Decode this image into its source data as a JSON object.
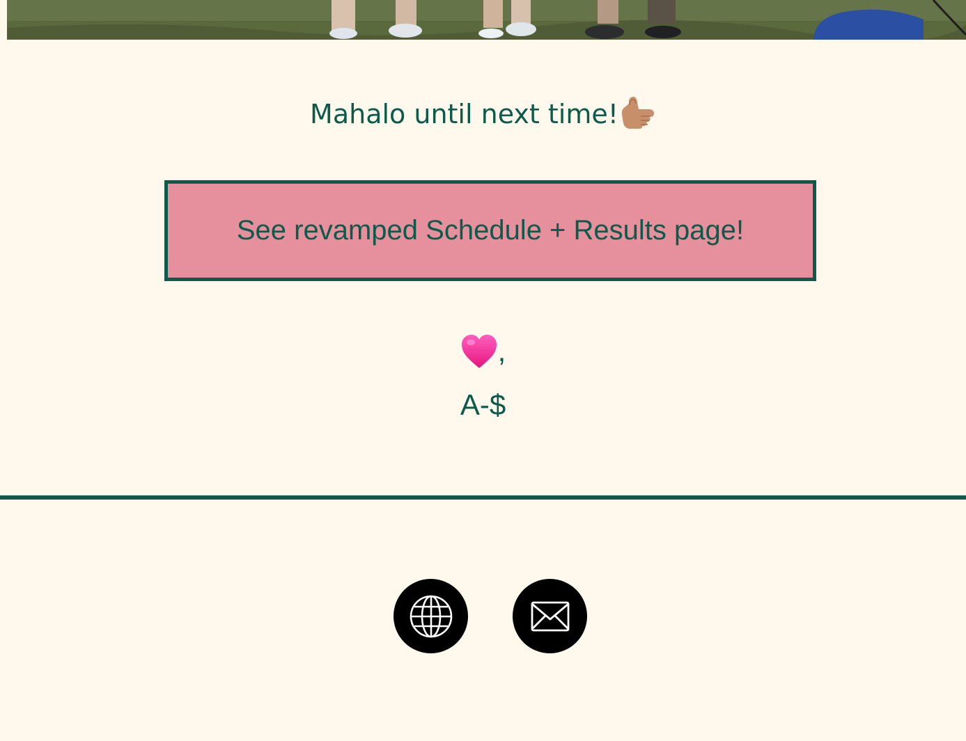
{
  "footer_message": {
    "text": "Mahalo until next time!",
    "emoji_icon": "call-me-hand-icon"
  },
  "cta": {
    "label": "See revamped Schedule + Results page!",
    "background": "#e68f9d",
    "border_color": "#0c5b4a"
  },
  "signoff": {
    "heart_icon": "pink-heart-icon",
    "comma": ",",
    "signature": "A-$"
  },
  "social_links": [
    {
      "icon": "globe-icon"
    },
    {
      "icon": "envelope-icon"
    }
  ],
  "colors": {
    "background": "#fff8ec",
    "accent": "#0c5b4a",
    "button_pink": "#e68f9d"
  }
}
